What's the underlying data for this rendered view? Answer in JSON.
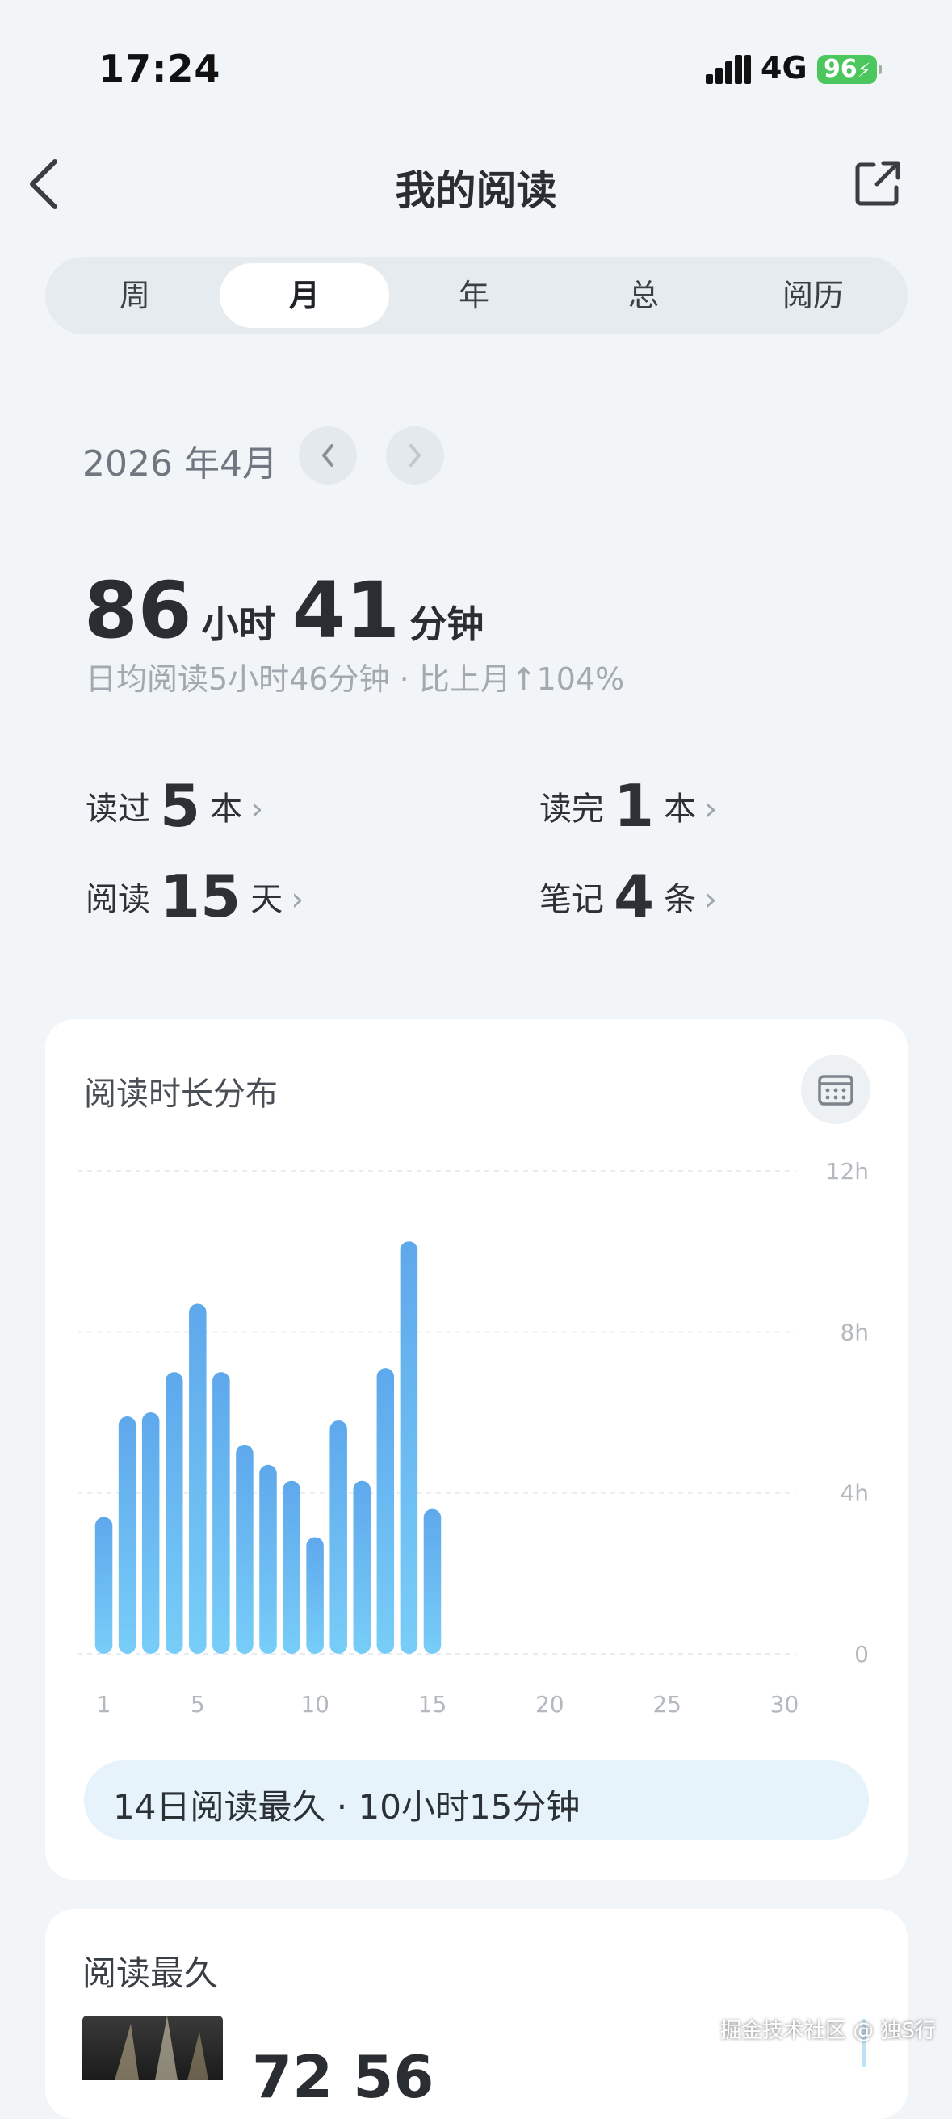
{
  "status_bar": {
    "time": "17:24",
    "network": "4G",
    "battery": "96"
  },
  "nav": {
    "title": "我的阅读"
  },
  "tabs": [
    {
      "label": "周",
      "active": false
    },
    {
      "label": "月",
      "active": true
    },
    {
      "label": "年",
      "active": false
    },
    {
      "label": "总",
      "active": false
    },
    {
      "label": "阅历",
      "active": false
    }
  ],
  "period": {
    "label": "2026 年4月"
  },
  "total": {
    "hours": "86",
    "hours_unit": "小时",
    "minutes": "41",
    "minutes_unit": "分钟",
    "daily_text": "日均阅读5小时46分钟 · 比上月↑104%"
  },
  "stats": [
    {
      "label": "读过",
      "value": "5",
      "unit": "本"
    },
    {
      "label": "读完",
      "value": "1",
      "unit": "本"
    },
    {
      "label": "阅读",
      "value": "15",
      "unit": "天"
    },
    {
      "label": "笔记",
      "value": "4",
      "unit": "条"
    }
  ],
  "chart_card": {
    "title": "阅读时长分布",
    "highlight": "14日阅读最久 · 10小时15分钟"
  },
  "chart_data": {
    "type": "bar",
    "x": [
      1,
      2,
      3,
      4,
      5,
      6,
      7,
      8,
      9,
      10,
      11,
      12,
      13,
      14,
      15
    ],
    "values": [
      3.4,
      5.9,
      6.0,
      7.0,
      8.7,
      7.0,
      5.2,
      4.7,
      4.3,
      2.9,
      5.8,
      4.3,
      7.1,
      10.25,
      3.6
    ],
    "xlim": [
      1,
      30
    ],
    "xticks": [
      "1",
      "5",
      "10",
      "15",
      "20",
      "25",
      "30"
    ],
    "ylim": [
      0,
      12
    ],
    "yticks": [
      "0",
      "4h",
      "8h",
      "12h"
    ],
    "grid": true,
    "colors": {
      "bar_top": "#5ea8ec",
      "bar_bottom": "#78cdf8",
      "grid": "#e8ecef",
      "tick": "#b3b9bf"
    }
  },
  "longest_card": {
    "title": "阅读最久",
    "value_partial": "72   56",
    "watermark": "掘金技术社区 @ 独S行"
  }
}
